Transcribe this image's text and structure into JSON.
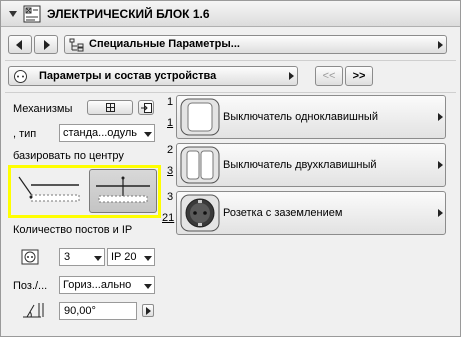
{
  "window": {
    "title": "ЭЛЕКТРИЧЕСКИЙ БЛОК 1.6"
  },
  "nav": {
    "section_label": "Специальные Параметры..."
  },
  "params": {
    "label": "Параметры и состав устройства",
    "prev_label": "<<",
    "next_label": ">>"
  },
  "left": {
    "mechanisms_label": "Механизмы",
    "type_label": ", тип",
    "type_value": "станда...одуль",
    "center_label": "базировать по центру",
    "count_label": "Количество постов и IP",
    "count_value": "3",
    "ip_value": "IP 20",
    "pos_label": "Поз./...",
    "pos_value": "Гориз...ально",
    "angle_value": "90,00°"
  },
  "devices": [
    {
      "num_top": "1",
      "num_bottom": "1",
      "label": "Выключатель одноклавишный"
    },
    {
      "num_top": "2",
      "num_bottom": "3",
      "label": "Выключатель двухклавишный"
    },
    {
      "num_top": "3",
      "num_bottom": "21",
      "label": "Розетка с заземлением"
    }
  ],
  "colors": {
    "highlight": "#ffff00",
    "background": "#f0f0f0"
  }
}
